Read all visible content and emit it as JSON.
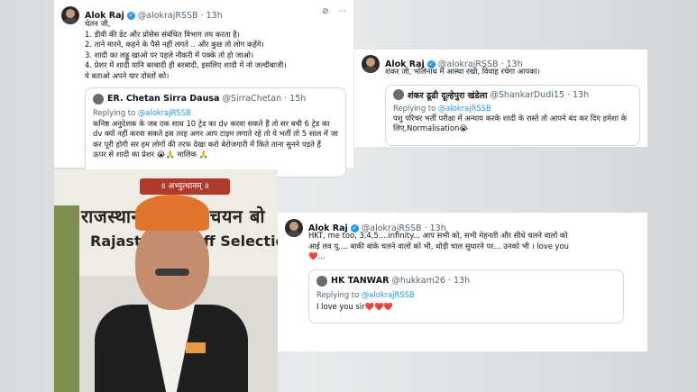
{
  "tweet1": {
    "name": "Alok Raj",
    "handle": "@alokrajRSSB",
    "time": "· 13h",
    "lines": [
      "चेतन जी,",
      "1. डीवी की डेट और प्रोसेस संबंधित विभाग तय करता है।",
      "2. ताने मारने, कहने के पैसे नहीं लगते .. और कुछ तो लोग कहेंगे।",
      "3. शादी का लड्डू खाओ पर पहले नौकरी में पक्के तो हो जाओ।",
      "4. प्रेशर में शादी यानि बरबादी ही बरबादी, इसलिए शादी में नो जल्दीबाजी।",
      "ये बताओ अपने यार दोस्तों को।"
    ],
    "quote": {
      "name": "ER. Chetan Sirra Dausa",
      "handle": "@SirraChetan",
      "time": "· 15h",
      "replying": "Replying to",
      "replying_handle": "@alokrajRSSB",
      "lines": [
        "कनिष्ठ अनुदेशक के जब एक साथ 10 ट्रेड का dv करवा सकते हैं तो सर बची 6 ट्रेड का",
        "dv क्यों नहीं करवा सकते इस तरह अगर आप टाइम लगाते रहे तो ये भर्ती तो 5 साल में जा",
        "कर पूरी होगी सर हम लोगों की तरफ देखा करो बेरोजगारी में किते ताना सुनने पड़ते हैं",
        "ऊपर से शादी का प्रेशर 😭🙏 मालिक 🙏"
      ]
    }
  },
  "tweet2": {
    "name": "Alok Raj",
    "handle": "@alokrajRSSB",
    "time": "· 13h",
    "text": "शंकर जी, भोलेनाथ में आस्था रखो, विवाह रचेगा आपका।",
    "quote": {
      "name": "शंकर ढूढी दूल्हेपुरा खंडेला",
      "handle": "@ShankarDudi15",
      "time": "· 13h",
      "replying": "Replying to",
      "replying_handle": "@alokrajRSSB",
      "lines": [
        "पशु परिचर भर्ती परीक्षा में अन्याय करके शादी के रास्ते तो आपने बंद कर दिए हमेशा के",
        "लिए,Normalisation😭"
      ]
    }
  },
  "tweet3": {
    "name": "Alok Raj",
    "handle": "@alokrajRSSB",
    "time": "· 13h",
    "lines": [
      "HKT, me too, 3,4,5....infinity... आप सभी को, सभी मेहनती और सीधे चलने वालों को",
      "आई लव यू.... बाकी बांके चलने वालों को भी, थोड़ी चाल सुधारने पर... उनको भी । love you",
      "❤️..."
    ],
    "quote": {
      "name": "HK TANWAR",
      "handle": "@hukkam26",
      "time": "· 13h",
      "replying": "Replying to",
      "replying_handle": "@alokrajRSSB",
      "text": "I love you sir❤️❤️❤️"
    }
  },
  "photo": {
    "sign_top": "॥ अभ्युत्थानम् ॥",
    "sign_line1": "राजस्थान कर्मचारी चयन बो",
    "sign_line2": "Rajasthan Staff Selection Board"
  }
}
